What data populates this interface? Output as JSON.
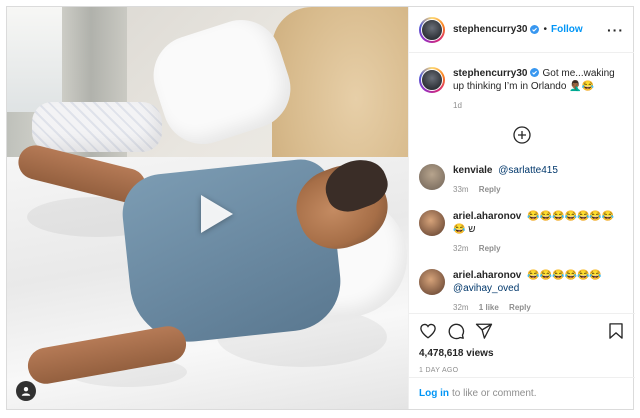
{
  "header": {
    "username": "stephencurry30",
    "separator": "•",
    "follow_label": "Follow",
    "more_label": "···"
  },
  "caption": {
    "username": "stephencurry30",
    "text": "Got me...waking up thinking I’m in Orlando 🤦🏾‍♂️😂",
    "age": "1d"
  },
  "comments": [
    {
      "username": "kenviale",
      "text": "@sarlatte415",
      "is_mention": true,
      "time": "33m",
      "likes": "",
      "reply": "Reply"
    },
    {
      "username": "ariel.aharonov",
      "text": "😂😂😂😂😂😂😂😂 ש",
      "is_mention": false,
      "time": "32m",
      "likes": "",
      "reply": "Reply"
    },
    {
      "username": "ariel.aharonov",
      "text": "😂😂😂😂😂😂",
      "mention": "@avihay_oved",
      "time": "32m",
      "likes": "1 like",
      "reply": "Reply"
    }
  ],
  "stats": {
    "views": "4,478,618 views",
    "posted": "1 DAY AGO"
  },
  "footer": {
    "login_label": "Log in",
    "login_suffix": "to like or comment."
  },
  "colors": {
    "accent": "#0095f6",
    "mention": "#00376b",
    "muted": "#8e8e8e"
  },
  "icons": [
    "play-icon",
    "user-tag-icon",
    "verified-badge-icon",
    "more-options-icon",
    "add-comment-icon",
    "heart-icon",
    "comment-icon",
    "share-icon",
    "bookmark-icon"
  ]
}
